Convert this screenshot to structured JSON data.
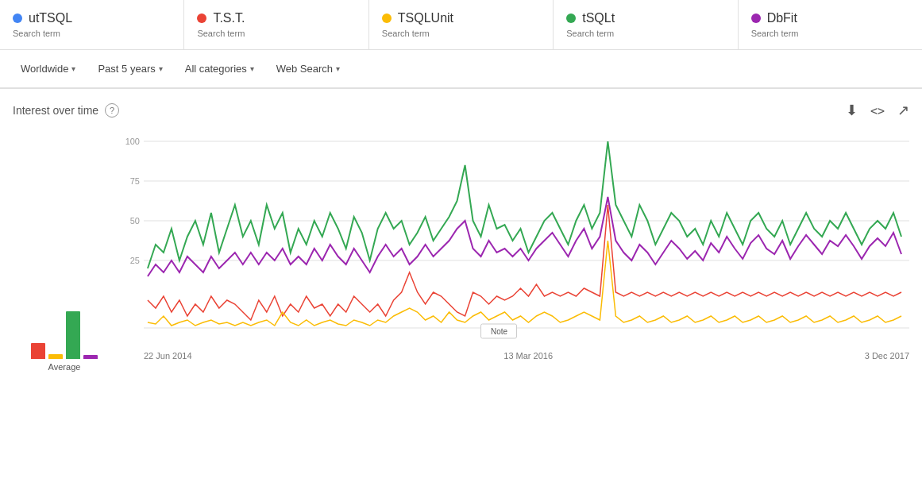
{
  "search_terms": [
    {
      "name": "utTSQL",
      "label": "Search term",
      "color": "#4285F4"
    },
    {
      "name": "T.S.T.",
      "label": "Search term",
      "color": "#EA4335"
    },
    {
      "name": "TSQLUnit",
      "label": "Search term",
      "color": "#FBBC05"
    },
    {
      "name": "tSQLt",
      "label": "Search term",
      "color": "#34A853"
    },
    {
      "name": "DbFit",
      "label": "Search term",
      "color": "#9C27B0"
    }
  ],
  "filters": {
    "region": "Worldwide",
    "time": "Past 5 years",
    "category": "All categories",
    "search_type": "Web Search"
  },
  "chart": {
    "title": "Interest over time",
    "y_labels": [
      "100",
      "75",
      "50",
      "25"
    ],
    "x_labels": [
      "22 Jun 2014",
      "13 Mar 2016",
      "3 Dec 2017"
    ],
    "avg_label": "Average"
  },
  "icons": {
    "download": "⬇",
    "embed": "<>",
    "share": "↗",
    "help": "?"
  }
}
